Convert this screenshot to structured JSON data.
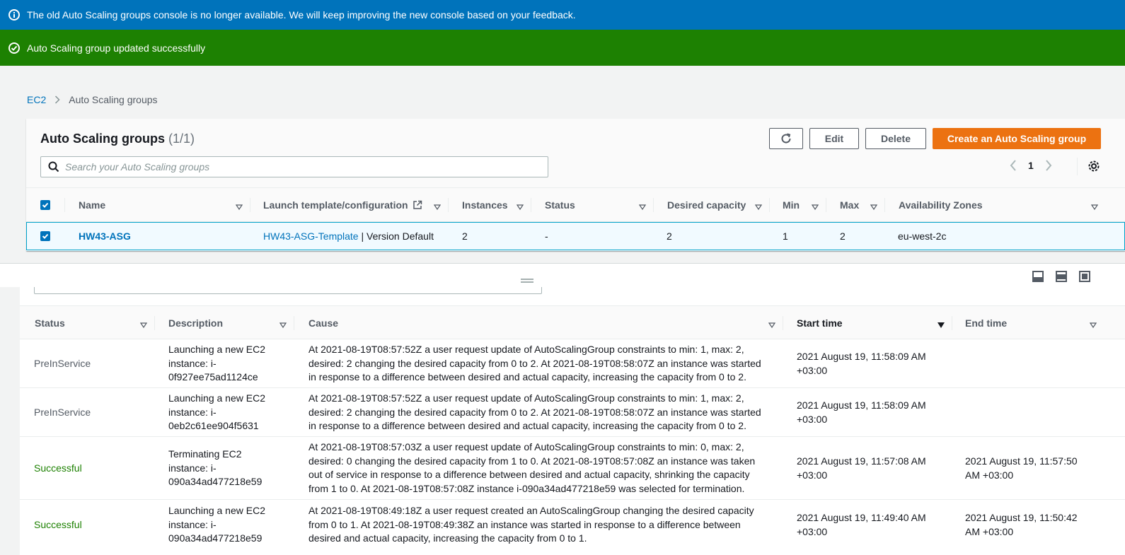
{
  "flash": {
    "info": "The old Auto Scaling groups console is no longer available. We will keep improving the new console based on your feedback.",
    "success": "Auto Scaling group updated successfully"
  },
  "breadcrumb": {
    "root": "EC2",
    "current": "Auto Scaling groups"
  },
  "asg_panel": {
    "title": "Auto Scaling groups",
    "count": "(1/1)",
    "buttons": {
      "edit": "Edit",
      "delete": "Delete",
      "create": "Create an Auto Scaling group"
    },
    "search_placeholder": "Search your Auto Scaling groups",
    "page_number": "1",
    "columns": [
      "Name",
      "Launch template/configuration",
      "Instances",
      "Status",
      "Desired capacity",
      "Min",
      "Max",
      "Availability Zones"
    ],
    "row": {
      "name": "HW43-ASG",
      "template_link": "HW43-ASG-Template",
      "template_suffix": " | Version Default",
      "instances": "2",
      "status": "-",
      "desired": "2",
      "min": "1",
      "max": "2",
      "zones": "eu-west-2c"
    }
  },
  "activity": {
    "columns": [
      "Status",
      "Description",
      "Cause",
      "Start time",
      "End time"
    ],
    "rows": [
      {
        "status": "PreInService",
        "description": [
          "Launching a new EC2",
          "instance: i-",
          "0f927ee75ad1124ce"
        ],
        "cause": [
          "At 2021-08-19T08:57:52Z a user request update of AutoScalingGroup constraints to min: 1, max: 2,",
          "desired: 2 changing the desired capacity from 0 to 2. At 2021-08-19T08:58:07Z an instance was started",
          "in response to a difference between desired and actual capacity, increasing the capacity from 0 to 2."
        ],
        "start": [
          "2021 August 19, 11:58:09 AM",
          "+03:00"
        ],
        "end": [
          "",
          ""
        ]
      },
      {
        "status": "PreInService",
        "description": [
          "Launching a new EC2",
          "instance: i-",
          "0eb2c61ee904f5631"
        ],
        "cause": [
          "At 2021-08-19T08:57:52Z a user request update of AutoScalingGroup constraints to min: 1, max: 2,",
          "desired: 2 changing the desired capacity from 0 to 2. At 2021-08-19T08:58:07Z an instance was started",
          "in response to a difference between desired and actual capacity, increasing the capacity from 0 to 2."
        ],
        "start": [
          "2021 August 19, 11:58:09 AM",
          "+03:00"
        ],
        "end": [
          "",
          ""
        ]
      },
      {
        "status": "Successful",
        "description": [
          "Terminating EC2",
          "instance: i-",
          "090a34ad477218e59"
        ],
        "cause": [
          "At 2021-08-19T08:57:03Z a user request update of AutoScalingGroup constraints to min: 0, max: 2,",
          "desired: 0 changing the desired capacity from 1 to 0. At 2021-08-19T08:57:08Z an instance was taken",
          "out of service in response to a difference between desired and actual capacity, shrinking the capacity",
          "from 1 to 0. At 2021-08-19T08:57:08Z instance i-090a34ad477218e59 was selected for termination."
        ],
        "start": [
          "2021 August 19, 11:57:08 AM",
          "+03:00"
        ],
        "end": [
          "2021 August 19, 11:57:50",
          "AM +03:00"
        ]
      },
      {
        "status": "Successful",
        "description": [
          "Launching a new EC2",
          "instance: i-",
          "090a34ad477218e59"
        ],
        "cause": [
          "At 2021-08-19T08:49:18Z a user request created an AutoScalingGroup changing the desired capacity",
          "from 0 to 1. At 2021-08-19T08:49:38Z an instance was started in response to a difference between",
          "desired and actual capacity, increasing the capacity from 0 to 1."
        ],
        "start": [
          "2021 August 19, 11:49:40 AM",
          "+03:00"
        ],
        "end": [
          "2021 August 19, 11:50:42",
          "AM +03:00"
        ]
      }
    ]
  }
}
